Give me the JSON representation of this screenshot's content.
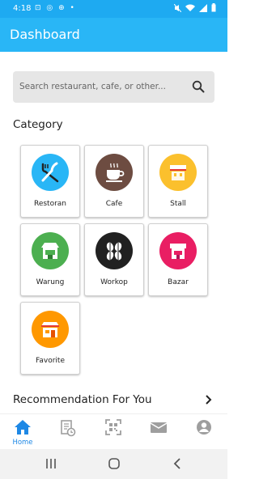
{
  "status_bar": {
    "time": "4:18",
    "notification_glyphs": "⊡ ◎ ⊕ •"
  },
  "app_bar": {
    "title": "Dashboard"
  },
  "search": {
    "placeholder": "Search restaurant, cafe, or other..."
  },
  "category": {
    "title": "Category",
    "items": [
      {
        "label": "Restoran",
        "icon": "fork-knife-icon",
        "color": "#29b6f6"
      },
      {
        "label": "Cafe",
        "icon": "coffee-cup-icon",
        "color": "#6d4c41"
      },
      {
        "label": "Stall",
        "icon": "stall-icon",
        "color": "#fbc02d"
      },
      {
        "label": "Warung",
        "icon": "warung-shop-icon",
        "color": "#4caf50"
      },
      {
        "label": "Workop",
        "icon": "coffee-beans-icon",
        "color": "#212121"
      },
      {
        "label": "Bazar",
        "icon": "bazar-shop-icon",
        "color": "#e91e63"
      },
      {
        "label": "Favorite",
        "icon": "favorite-shop-icon",
        "color": "#ff9800"
      }
    ]
  },
  "recommendation": {
    "title": "Recommendation For You"
  },
  "bottom_nav": {
    "items": [
      {
        "label": "Home",
        "icon": "home-icon",
        "active": true
      },
      {
        "label": "",
        "icon": "history-icon",
        "active": false
      },
      {
        "label": "",
        "icon": "qr-scan-icon",
        "active": false
      },
      {
        "label": "",
        "icon": "mail-icon",
        "active": false
      },
      {
        "label": "",
        "icon": "profile-icon",
        "active": false
      }
    ]
  },
  "colors": {
    "primary": "#29b6f6",
    "status": "#1eaaf1",
    "active_nav": "#1e88e5",
    "inactive_nav": "#9e9e9e"
  }
}
